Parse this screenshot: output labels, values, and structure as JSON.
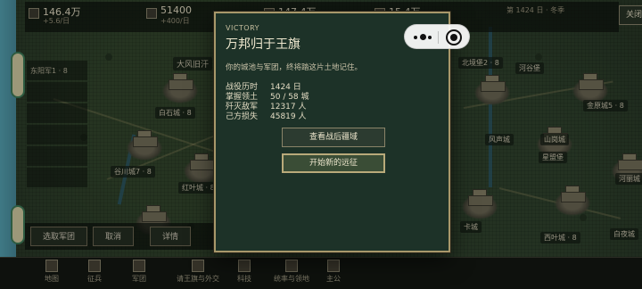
{
  "topbar": {
    "res1": {
      "value": "146.4万",
      "rate": "+5.6/日"
    },
    "res2": {
      "value": "51400",
      "rate": "+400/日"
    },
    "res3": {
      "value": "147.4万"
    },
    "res4": {
      "value": "15.4万"
    },
    "info": "第 1424 日 · 冬季"
  },
  "close_label": "关闭",
  "side_list": [
    "东阳军1 · 8",
    "",
    "",
    "",
    "",
    ""
  ],
  "map_labels": [
    "大风旧汗",
    "北境堡2 · 8",
    "河谷堡",
    "金原城5 · 8",
    "白石城 · 8",
    "谷川城7 · 8",
    "山岗城",
    "红叶城 · 8",
    "风声城",
    "星盟堡",
    "河丽城",
    "西叶城 · 8",
    "卡城",
    "白夜城"
  ],
  "bottom_buttons": {
    "select_army": "选取军团",
    "cancel": "取消",
    "details": "详情"
  },
  "nav": [
    "地图",
    "征兵",
    "军团",
    "请王旗与外交",
    "科技",
    "统率与领地",
    "主公"
  ],
  "modal": {
    "tag": "VICTORY",
    "title": "万邦归于王旗",
    "desc": "你的城池与军团，终将踏这片土地记住。",
    "stats": [
      {
        "key": "战役历时",
        "value": "1424 日"
      },
      {
        "key": "掌握领土",
        "value": "50 / 58 城"
      },
      {
        "key": "歼灭敌军",
        "value": "12317 人"
      },
      {
        "key": "己方损失",
        "value": "45819 人"
      }
    ],
    "btn_view": "查看战后疆域",
    "btn_new": "开始新的远征"
  }
}
